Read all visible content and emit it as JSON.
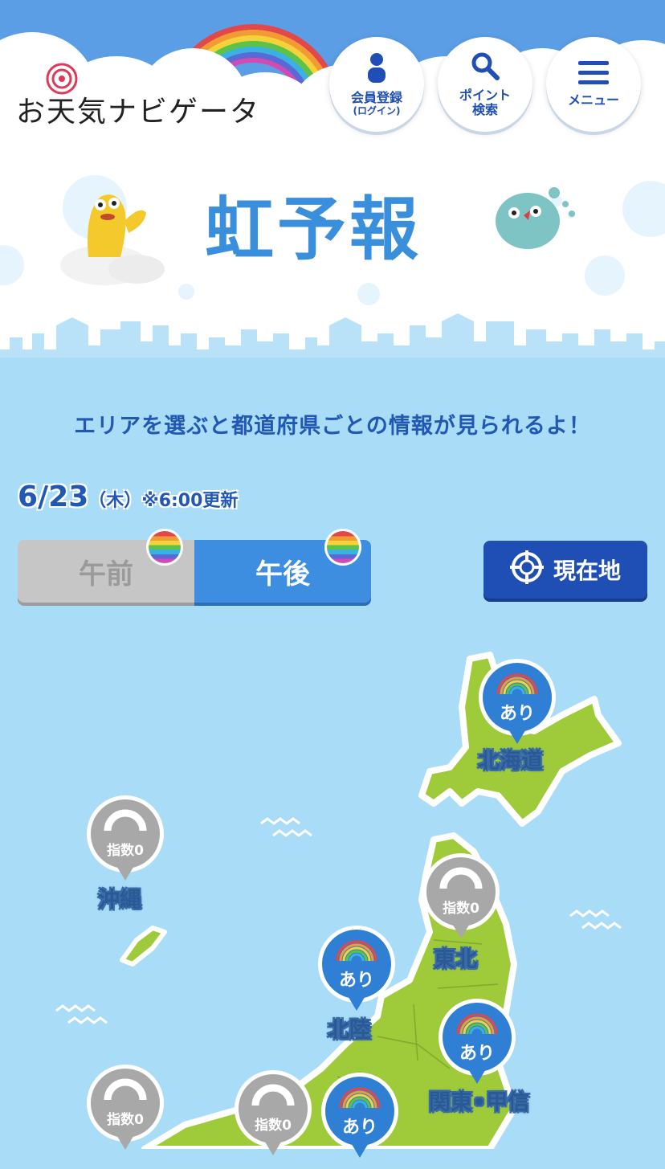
{
  "header": {
    "logo_text": "お天気ナビゲータ",
    "buttons": [
      {
        "label": "会員登録",
        "sublabel": "(ログイン)",
        "icon": "person-icon"
      },
      {
        "label": "ポイント",
        "sublabel": "検索",
        "icon": "search-icon"
      },
      {
        "label": "メニュー",
        "sublabel": "",
        "icon": "hamburger-menu-icon"
      }
    ]
  },
  "page": {
    "title": "虹予報",
    "intro": "エリアを選ぶと都道府県ごとの情報が見られるよ！"
  },
  "date": {
    "date": "6/23",
    "weekday": "（木）",
    "update": "※6:00更新"
  },
  "toggle": {
    "am": "午前",
    "pm": "午後",
    "selected": "午後"
  },
  "locate_button": "現在地",
  "regions": [
    {
      "name": "北海道",
      "status": "あり",
      "kind": "rainbow"
    },
    {
      "name": "沖縄",
      "status": "指数0",
      "kind": "none"
    },
    {
      "name": "東北",
      "status": "指数0",
      "kind": "none"
    },
    {
      "name": "北陸",
      "status": "あり",
      "kind": "rainbow"
    },
    {
      "name": "関東•甲信",
      "status": "あり",
      "kind": "rainbow"
    },
    {
      "name": "",
      "status": "指数0",
      "kind": "none"
    },
    {
      "name": "",
      "status": "指数0",
      "kind": "none"
    },
    {
      "name": "",
      "status": "あり",
      "kind": "rainbow"
    }
  ],
  "colors": {
    "sky": "#5b9ee6",
    "sea": "#a9dcf6",
    "land": "#9fcb3a",
    "accent_blue": "#2f7fd4",
    "text_blue": "#2158b3",
    "none_gray": "#a8a8a8"
  }
}
